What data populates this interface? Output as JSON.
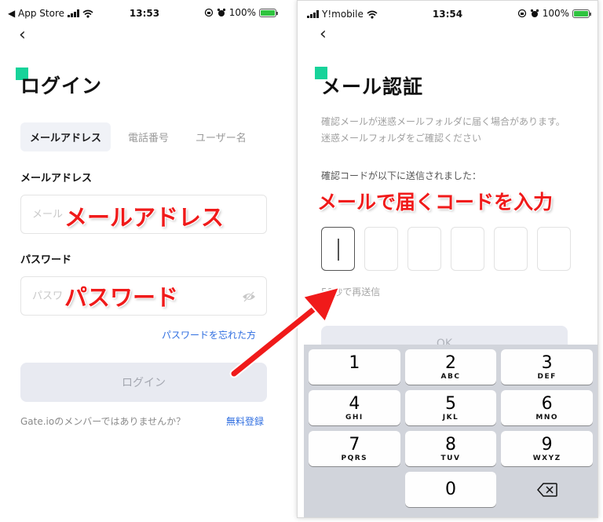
{
  "left_screen": {
    "status": {
      "carrier": "◀ App Store",
      "time": "13:53",
      "battery": "100%"
    },
    "title": "ログイン",
    "tabs": [
      {
        "label": "メールアドレス",
        "active": true
      },
      {
        "label": "電話番号",
        "active": false
      },
      {
        "label": "ユーザー名",
        "active": false
      }
    ],
    "email_label": "メールアドレス",
    "email_placeholder": "メール",
    "password_label": "パスワード",
    "password_placeholder": "パスワ",
    "forgot_link": "パスワードを忘れた方",
    "login_button": "ログイン",
    "footer_text": "Gate.ioのメンバーではありませんか？",
    "register_link": "無料登録"
  },
  "right_screen": {
    "status": {
      "carrier": "Y!mobile",
      "time": "13:54",
      "battery": "100%"
    },
    "title": "メール認証",
    "description": "確認メールが迷惑メールフォルダに届く場合があります。迷惑メールフォルダをご確認ください",
    "code_label": "確認コードが以下に送信されました：",
    "code_digits": [
      "",
      "",
      "",
      "",
      "",
      ""
    ],
    "resend_text": "58秒で再送信",
    "ok_button": "OK",
    "keypad": [
      [
        {
          "digit": "1",
          "letters": ""
        },
        {
          "digit": "2",
          "letters": "ABC"
        },
        {
          "digit": "3",
          "letters": "DEF"
        }
      ],
      [
        {
          "digit": "4",
          "letters": "GHI"
        },
        {
          "digit": "5",
          "letters": "JKL"
        },
        {
          "digit": "6",
          "letters": "MNO"
        }
      ],
      [
        {
          "digit": "7",
          "letters": "PQRS"
        },
        {
          "digit": "8",
          "letters": "TUV"
        },
        {
          "digit": "9",
          "letters": "WXYZ"
        }
      ],
      [
        {
          "digit": "",
          "letters": ""
        },
        {
          "digit": "0",
          "letters": ""
        },
        {
          "digit": "⌫",
          "letters": ""
        }
      ]
    ]
  },
  "annotations": {
    "email": "メールアドレス",
    "password": "パスワード",
    "code": "メールで届くコードを入力"
  },
  "colors": {
    "accent": "#17d39a",
    "annotation_red": "#f01a1a",
    "link_blue": "#2f6ee0",
    "button_disabled": "#e8eaf1"
  }
}
